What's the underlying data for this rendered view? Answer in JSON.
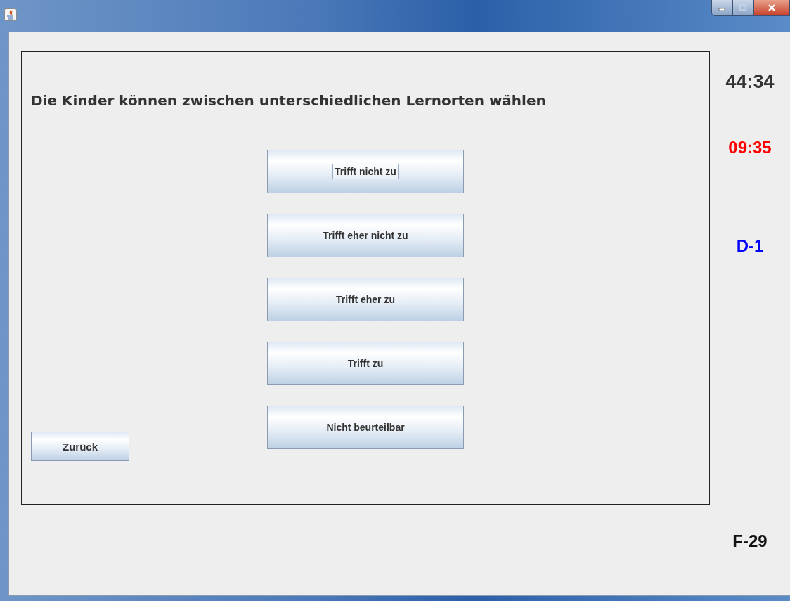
{
  "question": "Die Kinder können zwischen unterschiedlichen Lernorten wählen",
  "options": [
    {
      "label": "Trifft nicht zu",
      "focused": true
    },
    {
      "label": "Trifft eher nicht zu",
      "focused": false
    },
    {
      "label": "Trifft eher zu",
      "focused": false
    },
    {
      "label": "Trifft zu",
      "focused": false
    },
    {
      "label": "Nicht beurteilbar",
      "focused": false
    }
  ],
  "back_button": "Zurück",
  "total_time": "44:34",
  "remaining_time": "09:35",
  "section": "D-1",
  "question_number": "F-29"
}
